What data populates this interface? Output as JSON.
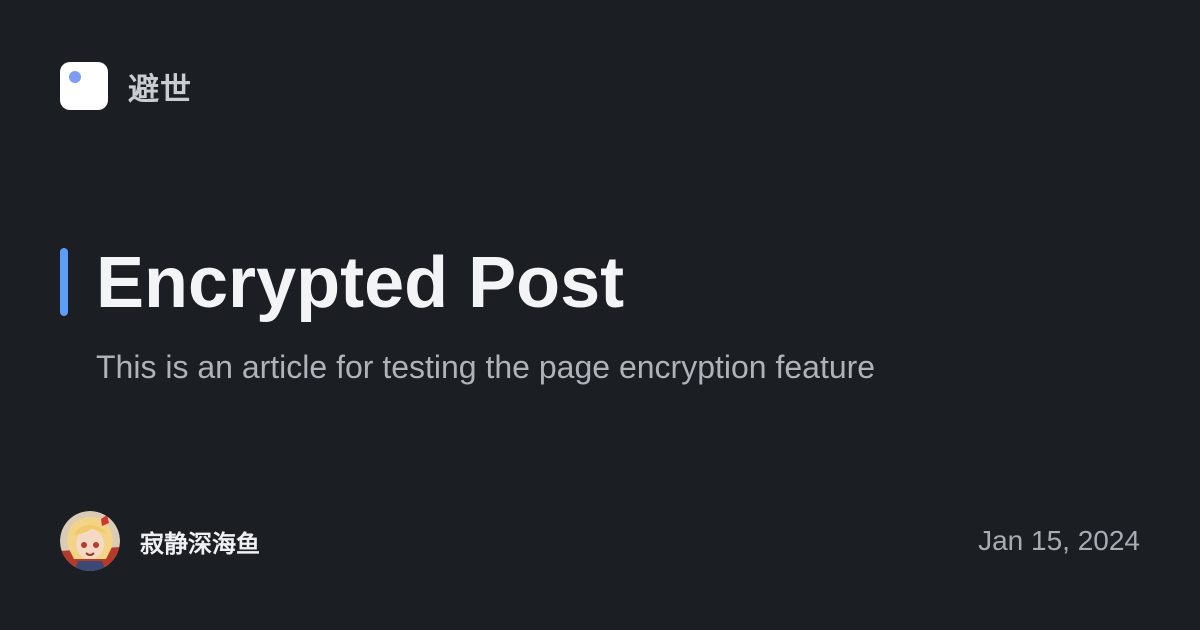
{
  "site": {
    "name": "避世",
    "logo_icon": "square-dot-logo-icon"
  },
  "post": {
    "title": "Encrypted Post",
    "description": "This is an article for testing the page encryption feature",
    "date": "Jan 15, 2024"
  },
  "author": {
    "name": "寂静深海鱼",
    "avatar_icon": "anime-avatar-icon"
  },
  "colors": {
    "background": "#1b1e22",
    "accent": "#5b9df9",
    "logo_dot": "#7f9cf5",
    "title": "#f3f4f6",
    "muted_text": "#aeb3ba"
  }
}
